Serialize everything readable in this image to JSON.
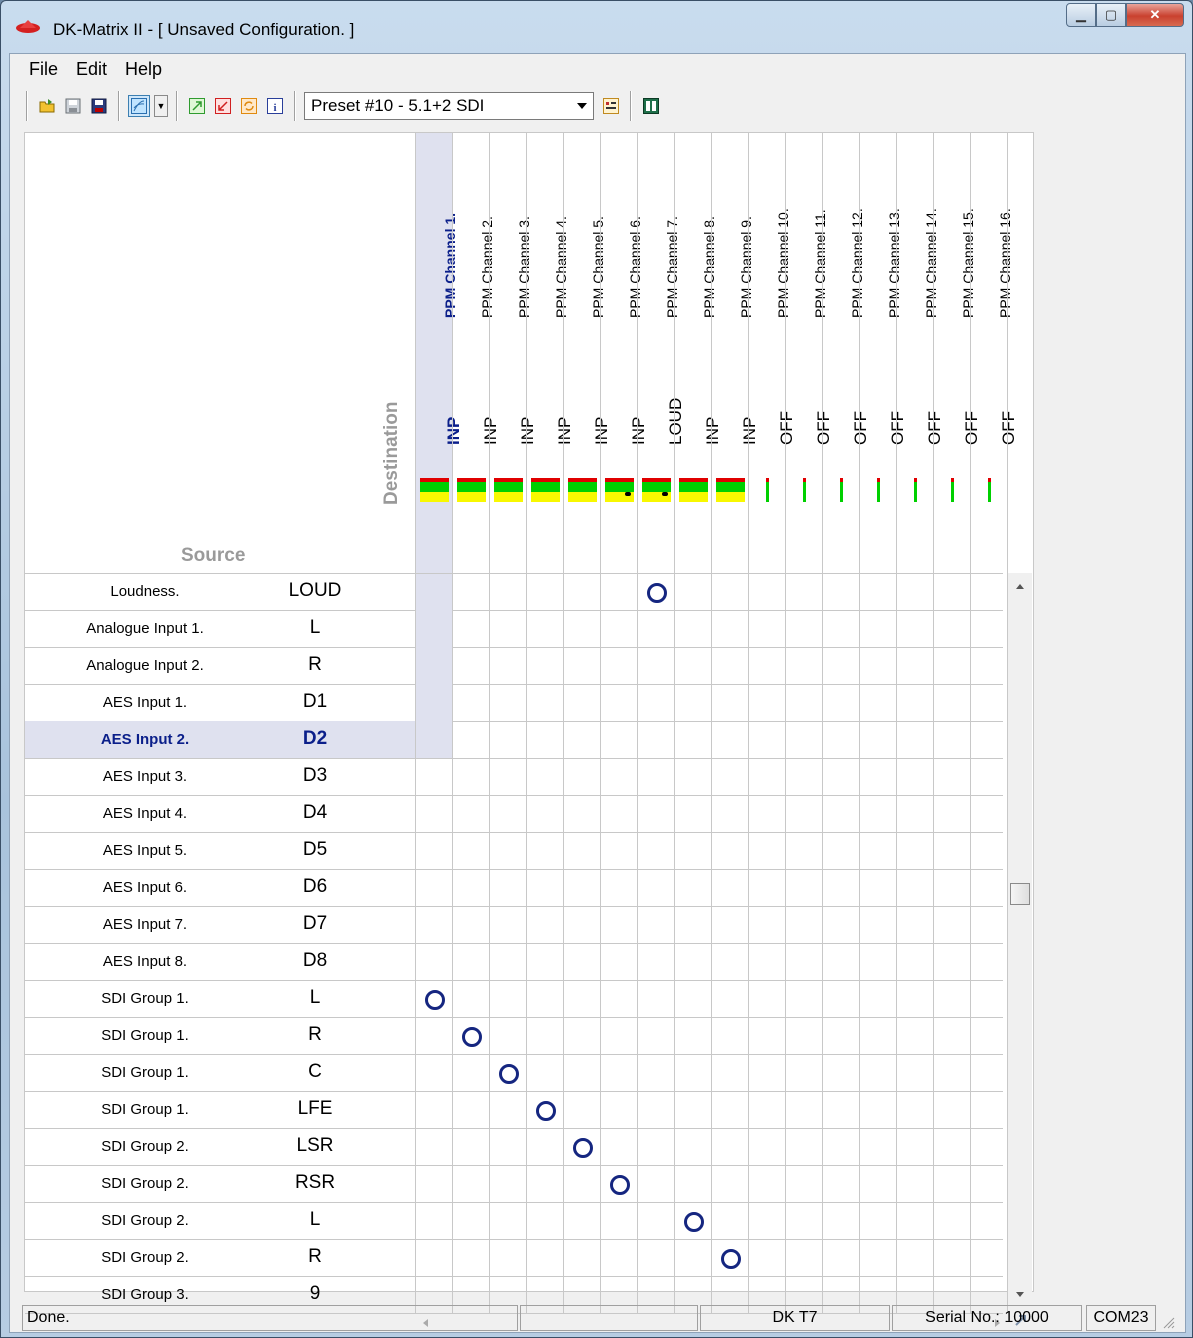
{
  "window": {
    "title": "DK-Matrix II - [ Unsaved Configuration. ]"
  },
  "menu": {
    "file": "File",
    "edit": "Edit",
    "help": "Help"
  },
  "toolbar": {
    "preset": "Preset #10 - 5.1+2 SDI",
    "icons": [
      "open-folder",
      "save",
      "save-as",
      "routing-view",
      "dropdown",
      "export-green",
      "import-red",
      "refresh-orange",
      "info",
      "preset-list",
      "device"
    ]
  },
  "grid": {
    "destination_label": "Destination",
    "source_label": "Source",
    "columns": [
      {
        "name": "PPM Channel 1.",
        "mode": "INP",
        "selected": true
      },
      {
        "name": "PPM Channel 2.",
        "mode": "INP"
      },
      {
        "name": "PPM Channel 3.",
        "mode": "INP"
      },
      {
        "name": "PPM Channel 4.",
        "mode": "INP"
      },
      {
        "name": "PPM Channel 5.",
        "mode": "INP"
      },
      {
        "name": "PPM Channel 6.",
        "mode": "INP",
        "meter_marker": true
      },
      {
        "name": "PPM Channel 7.",
        "mode": "LOUD",
        "meter_marker": true
      },
      {
        "name": "PPM Channel 8.",
        "mode": "INP"
      },
      {
        "name": "PPM Channel 9.",
        "mode": "INP"
      },
      {
        "name": "PPM Channel 10.",
        "mode": "OFF"
      },
      {
        "name": "PPM Channel 11.",
        "mode": "OFF"
      },
      {
        "name": "PPM Channel 12.",
        "mode": "OFF"
      },
      {
        "name": "PPM Channel 13.",
        "mode": "OFF"
      },
      {
        "name": "PPM Channel 14.",
        "mode": "OFF"
      },
      {
        "name": "PPM Channel 15.",
        "mode": "OFF"
      },
      {
        "name": "PPM Channel 16.",
        "mode": "OFF"
      }
    ],
    "rows": [
      {
        "name": "Loudness.",
        "short": "LOUD"
      },
      {
        "name": "Analogue Input 1.",
        "short": "L"
      },
      {
        "name": "Analogue Input 2.",
        "short": "R"
      },
      {
        "name": "AES Input 1.",
        "short": "D1"
      },
      {
        "name": "AES Input 2.",
        "short": "D2",
        "selected": true
      },
      {
        "name": "AES Input 3.",
        "short": "D3"
      },
      {
        "name": "AES Input 4.",
        "short": "D4"
      },
      {
        "name": "AES Input 5.",
        "short": "D5"
      },
      {
        "name": "AES Input 6.",
        "short": "D6"
      },
      {
        "name": "AES Input 7.",
        "short": "D7"
      },
      {
        "name": "AES Input 8.",
        "short": "D8"
      },
      {
        "name": "SDI Group 1.",
        "short": "L"
      },
      {
        "name": "SDI Group 1.",
        "short": "R"
      },
      {
        "name": "SDI Group 1.",
        "short": "C"
      },
      {
        "name": "SDI Group 1.",
        "short": "LFE"
      },
      {
        "name": "SDI Group 2.",
        "short": "LSR"
      },
      {
        "name": "SDI Group 2.",
        "short": "RSR"
      },
      {
        "name": "SDI Group 2.",
        "short": "L"
      },
      {
        "name": "SDI Group 2.",
        "short": "R"
      },
      {
        "name": "SDI Group 3.",
        "short": "9"
      }
    ],
    "routes": [
      [
        0,
        6
      ],
      [
        11,
        0
      ],
      [
        12,
        1
      ],
      [
        13,
        2
      ],
      [
        14,
        3
      ],
      [
        15,
        4
      ],
      [
        16,
        5
      ],
      [
        17,
        7
      ],
      [
        18,
        8
      ]
    ]
  },
  "status": {
    "message": "Done.",
    "panel2": "",
    "panel3": "",
    "device": "DK T7",
    "serial": "Serial No.: 10000",
    "port": "COM23"
  }
}
